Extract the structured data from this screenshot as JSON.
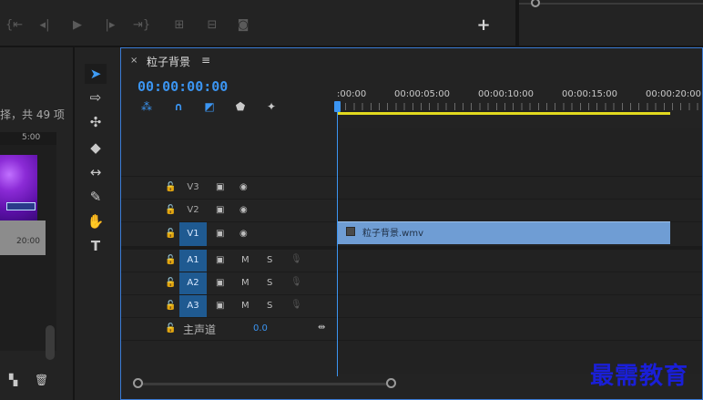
{
  "transport": {
    "buttons": [
      "mark-in-icon",
      "step-back-icon",
      "play-icon",
      "step-forward-icon",
      "go-to-out-icon",
      "insert-icon",
      "overwrite-icon",
      "camera-icon"
    ],
    "add_label": "+"
  },
  "project": {
    "item_count_label": "择，共 49 项",
    "header_time": "5:00",
    "item_duration": "20:00"
  },
  "tools": [
    "selection-tool-icon",
    "track-select-icon",
    "ripple-edit-icon",
    "razor-icon",
    "slip-icon",
    "pen-icon",
    "hand-icon",
    "type-icon"
  ],
  "timeline": {
    "close_label": "×",
    "sequence_name": "粒子背景",
    "menu_label": "≡",
    "timecode": "00:00:00:00",
    "ruler": [
      ":00:00",
      "00:00:05:00",
      "00:00:10:00",
      "00:00:15:00",
      "00:00:20:00"
    ],
    "video_tracks": [
      "V3",
      "V2",
      "V1"
    ],
    "audio_tracks": [
      "A1",
      "A2",
      "A3"
    ],
    "mute_label": "M",
    "solo_label": "S",
    "mix_label": "主声道",
    "mix_value": "0.0",
    "clip_name": "粒子背景.wmv"
  },
  "watermark": "最需教育",
  "colors": {
    "accent": "#3b95f2",
    "clip": "#6f9dd4",
    "work_area": "#e2d91f",
    "watermark": "#1a1fd8"
  }
}
